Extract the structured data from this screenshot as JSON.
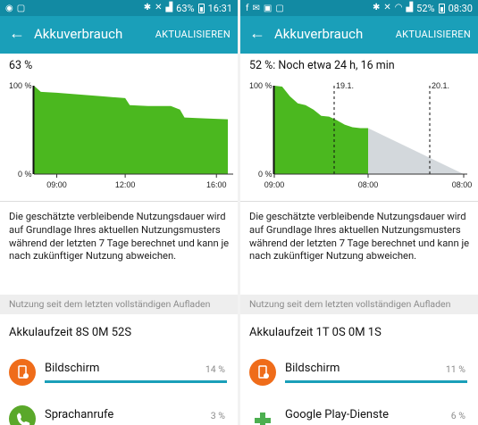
{
  "left": {
    "status": {
      "percent": "63%",
      "time": "16:31"
    },
    "toolbar": {
      "title": "Akkuverbrauch",
      "action": "AKTUALISIEREN"
    },
    "battery_summary": "63 %",
    "chart_data": {
      "type": "area",
      "y_labels": [
        "100 %",
        "0 %"
      ],
      "x_ticks": [
        "09:00",
        "12:00",
        "16:00"
      ],
      "ylim": [
        0,
        100
      ],
      "x_hours": [
        8.0,
        8.3,
        9.0,
        10.0,
        11.0,
        12.0,
        12.2,
        13.0,
        14.0,
        14.4,
        14.6,
        15.5,
        16.5
      ],
      "values": [
        100,
        93,
        92,
        90,
        88,
        86,
        78,
        77,
        77,
        73,
        64,
        63,
        62
      ]
    },
    "description": "Die geschätzte verbleibende Nutzungsdauer wird auf Grundlage Ihres aktuellen Nutzungsmusters während der letzten 7 Tage berechnet und kann je nach zukünftiger Nutzung abweichen.",
    "section_header": "Nutzung seit dem letzten vollständigen Aufladen",
    "runtime": "Akkulaufzeit 8S 0M 52S",
    "apps": [
      {
        "name": "Bildschirm",
        "percent": "14 %",
        "fill": 1.0,
        "icon": "screen-icon",
        "color": "#ef6c1a"
      },
      {
        "name": "Sprachanrufe",
        "percent": "3 %",
        "fill": 0.2,
        "icon": "phone-icon",
        "color": "#5aa82a"
      }
    ]
  },
  "right": {
    "status": {
      "percent": "52%",
      "time": "08:30"
    },
    "toolbar": {
      "title": "Akkuverbrauch",
      "action": "AKTUALISIEREN"
    },
    "battery_summary": "52 %: Noch etwa 24 h, 16 min",
    "chart_data": {
      "type": "area",
      "y_labels": [
        "100 %",
        "0 %"
      ],
      "x_ticks": [
        "09:00",
        "08:00",
        "08:00"
      ],
      "markers": [
        "19.1.",
        "20.1."
      ],
      "ylim": [
        0,
        100
      ],
      "actual": [
        100,
        99,
        88,
        80,
        78,
        73,
        66,
        65,
        61,
        56,
        53,
        52,
        52
      ],
      "prediction_end": 0
    },
    "description": "Die geschätzte verbleibende Nutzungsdauer wird auf Grundlage Ihres aktuellen Nutzungsmusters während der letzten 7 Tage berechnet und kann je nach zukünftiger Nutzung abweichen.",
    "section_header": "Nutzung seit dem letzten vollständigen Aufladen",
    "runtime": "Akkulaufzeit 1T 0S 0M 1S",
    "apps": [
      {
        "name": "Bildschirm",
        "percent": "11 %",
        "fill": 1.0,
        "icon": "screen-icon",
        "color": "#ef6c1a"
      },
      {
        "name": "Google Play-Dienste",
        "percent": "6 %",
        "fill": 0.5,
        "icon": "puzzle-icon",
        "color": "#4caf50"
      }
    ]
  },
  "colors": {
    "statusbar": "#128aa3",
    "toolbar": "#1a9fb9",
    "battery_fill": "#4bb81f",
    "prediction_fill": "#d3d8dc",
    "accent": "#1a9fb9"
  }
}
